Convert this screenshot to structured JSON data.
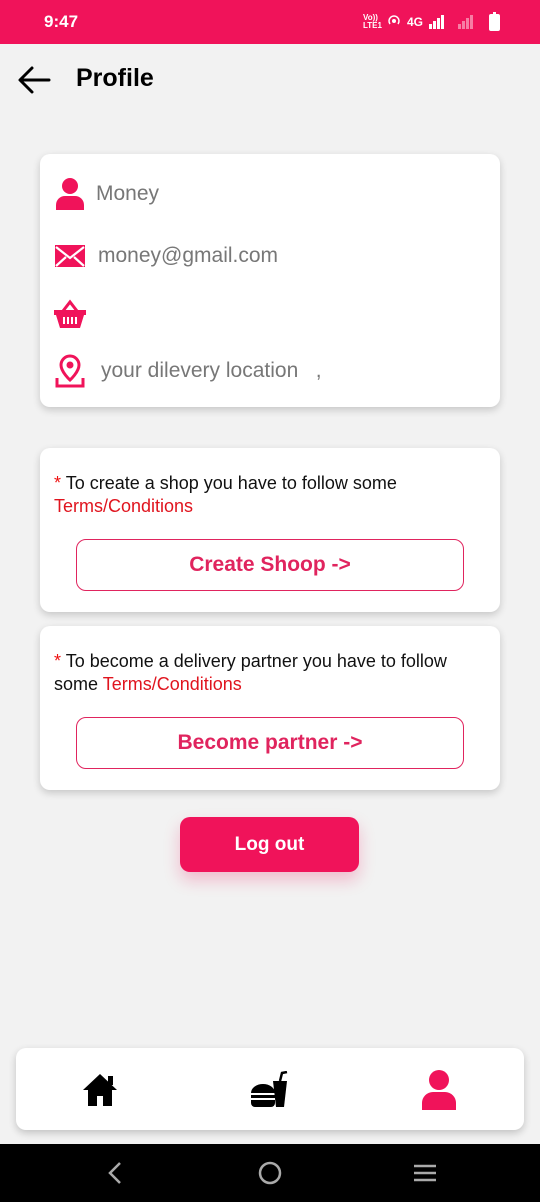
{
  "status": {
    "time": "9:47",
    "network": "4G",
    "volte": "Vo)) LTE1"
  },
  "header": {
    "title": "Profile"
  },
  "profile": {
    "name": "Money",
    "email": "money@gmail.com",
    "shop": "",
    "location": "your dilevery location   ,"
  },
  "shop_card": {
    "star": "*",
    "text": "To create a shop you have to follow some",
    "terms": "Terms/Conditions",
    "button": "Create Shoop ->"
  },
  "partner_card": {
    "star": "*",
    "text": "To become a delivery partner you have to follow some",
    "terms": "Terms/Conditions",
    "button": "Become partner ->"
  },
  "logout": {
    "label": "Log out"
  },
  "colors": {
    "accent": "#f0135a",
    "terms": "#e0141e",
    "text_muted": "#777777"
  },
  "bottom_nav": {
    "items": [
      "home-icon",
      "food-icon",
      "profile-icon"
    ],
    "active": "profile-icon"
  }
}
